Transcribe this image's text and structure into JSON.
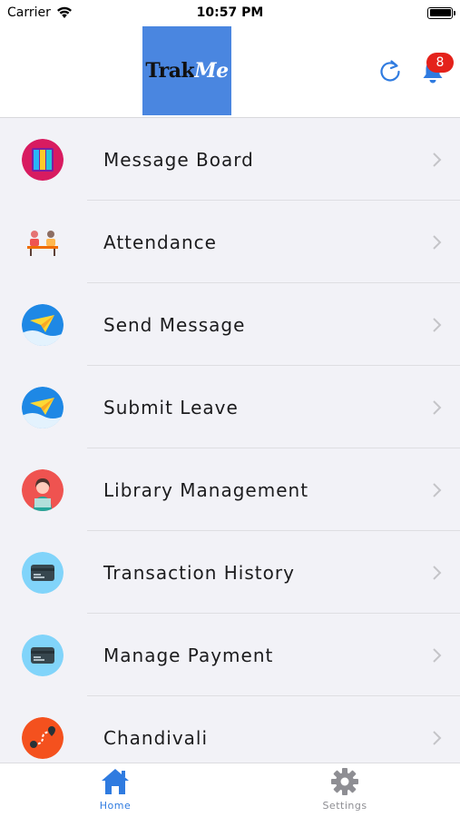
{
  "status_bar": {
    "carrier": "Carrier",
    "time": "10:57 PM"
  },
  "header": {
    "logo_trak": "Trak",
    "logo_me": "Me",
    "notification_count": "8"
  },
  "menu": {
    "items": [
      {
        "label": "Message Board",
        "icon": "message-board-icon"
      },
      {
        "label": "Attendance",
        "icon": "attendance-icon"
      },
      {
        "label": "Send Message",
        "icon": "paper-plane-icon"
      },
      {
        "label": "Submit Leave",
        "icon": "paper-plane-icon"
      },
      {
        "label": "Library Management",
        "icon": "reader-icon"
      },
      {
        "label": "Transaction History",
        "icon": "credit-card-icon"
      },
      {
        "label": "Manage Payment",
        "icon": "credit-card-icon"
      },
      {
        "label": "Chandivali",
        "icon": "route-icon"
      }
    ]
  },
  "tabbar": {
    "home_label": "Home",
    "settings_label": "Settings"
  },
  "colors": {
    "accent": "#2f7be0",
    "logo_bg": "#4a86e0",
    "badge": "#e4221b"
  }
}
